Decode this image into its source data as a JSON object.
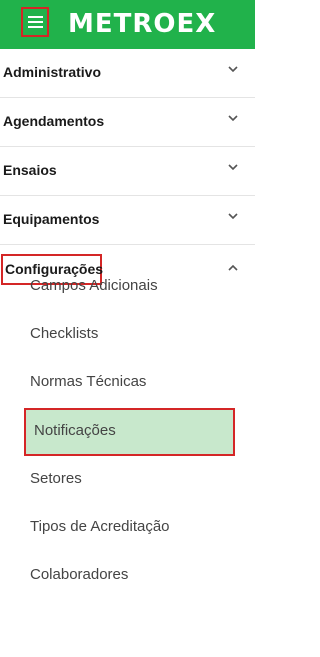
{
  "header": {
    "logo": "METROEX",
    "menu_icon": "hamburger-icon",
    "background": "#21b24b"
  },
  "menu": {
    "items": [
      {
        "label": "Administrativo",
        "icon": "chevron-down-icon"
      },
      {
        "label": "Agendamentos",
        "icon": "chevron-down-icon"
      },
      {
        "label": "Ensaios",
        "icon": "chevron-down-icon"
      },
      {
        "label": "Equipamentos",
        "icon": "chevron-down-icon"
      },
      {
        "label": "Configurações",
        "icon": "chevron-up-icon"
      }
    ]
  },
  "submenu": {
    "items": [
      {
        "label": "Campos Adicionais"
      },
      {
        "label": "Checklists"
      },
      {
        "label": "Normas Técnicas"
      },
      {
        "label": "Notificações",
        "active": true
      },
      {
        "label": "Setores"
      },
      {
        "label": "Tipos de Acreditação"
      },
      {
        "label": "Colaboradores"
      }
    ]
  },
  "colors": {
    "highlight": "#d42626",
    "active_bg": "#c8e8cc"
  }
}
